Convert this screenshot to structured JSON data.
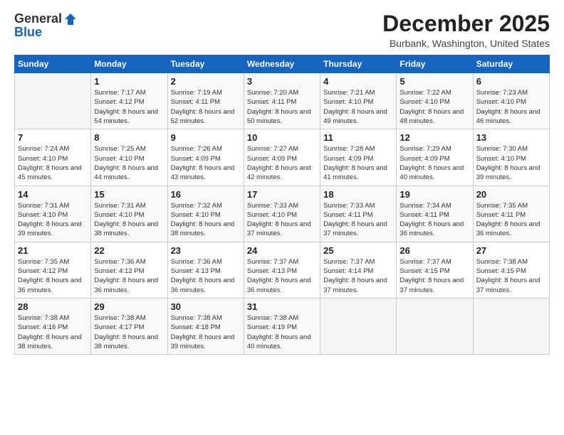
{
  "logo": {
    "general": "General",
    "blue": "Blue"
  },
  "title": "December 2025",
  "location": "Burbank, Washington, United States",
  "days_of_week": [
    "Sunday",
    "Monday",
    "Tuesday",
    "Wednesday",
    "Thursday",
    "Friday",
    "Saturday"
  ],
  "weeks": [
    [
      {
        "day": "",
        "sunrise": "",
        "sunset": "",
        "daylight": ""
      },
      {
        "day": "1",
        "sunrise": "Sunrise: 7:17 AM",
        "sunset": "Sunset: 4:12 PM",
        "daylight": "Daylight: 8 hours and 54 minutes."
      },
      {
        "day": "2",
        "sunrise": "Sunrise: 7:19 AM",
        "sunset": "Sunset: 4:11 PM",
        "daylight": "Daylight: 8 hours and 52 minutes."
      },
      {
        "day": "3",
        "sunrise": "Sunrise: 7:20 AM",
        "sunset": "Sunset: 4:11 PM",
        "daylight": "Daylight: 8 hours and 50 minutes."
      },
      {
        "day": "4",
        "sunrise": "Sunrise: 7:21 AM",
        "sunset": "Sunset: 4:10 PM",
        "daylight": "Daylight: 8 hours and 49 minutes."
      },
      {
        "day": "5",
        "sunrise": "Sunrise: 7:22 AM",
        "sunset": "Sunset: 4:10 PM",
        "daylight": "Daylight: 8 hours and 48 minutes."
      },
      {
        "day": "6",
        "sunrise": "Sunrise: 7:23 AM",
        "sunset": "Sunset: 4:10 PM",
        "daylight": "Daylight: 8 hours and 46 minutes."
      }
    ],
    [
      {
        "day": "7",
        "sunrise": "Sunrise: 7:24 AM",
        "sunset": "Sunset: 4:10 PM",
        "daylight": "Daylight: 8 hours and 45 minutes."
      },
      {
        "day": "8",
        "sunrise": "Sunrise: 7:25 AM",
        "sunset": "Sunset: 4:10 PM",
        "daylight": "Daylight: 8 hours and 44 minutes."
      },
      {
        "day": "9",
        "sunrise": "Sunrise: 7:26 AM",
        "sunset": "Sunset: 4:09 PM",
        "daylight": "Daylight: 8 hours and 43 minutes."
      },
      {
        "day": "10",
        "sunrise": "Sunrise: 7:27 AM",
        "sunset": "Sunset: 4:09 PM",
        "daylight": "Daylight: 8 hours and 42 minutes."
      },
      {
        "day": "11",
        "sunrise": "Sunrise: 7:28 AM",
        "sunset": "Sunset: 4:09 PM",
        "daylight": "Daylight: 8 hours and 41 minutes."
      },
      {
        "day": "12",
        "sunrise": "Sunrise: 7:29 AM",
        "sunset": "Sunset: 4:09 PM",
        "daylight": "Daylight: 8 hours and 40 minutes."
      },
      {
        "day": "13",
        "sunrise": "Sunrise: 7:30 AM",
        "sunset": "Sunset: 4:10 PM",
        "daylight": "Daylight: 8 hours and 39 minutes."
      }
    ],
    [
      {
        "day": "14",
        "sunrise": "Sunrise: 7:31 AM",
        "sunset": "Sunset: 4:10 PM",
        "daylight": "Daylight: 8 hours and 39 minutes."
      },
      {
        "day": "15",
        "sunrise": "Sunrise: 7:31 AM",
        "sunset": "Sunset: 4:10 PM",
        "daylight": "Daylight: 8 hours and 38 minutes."
      },
      {
        "day": "16",
        "sunrise": "Sunrise: 7:32 AM",
        "sunset": "Sunset: 4:10 PM",
        "daylight": "Daylight: 8 hours and 38 minutes."
      },
      {
        "day": "17",
        "sunrise": "Sunrise: 7:33 AM",
        "sunset": "Sunset: 4:10 PM",
        "daylight": "Daylight: 8 hours and 37 minutes."
      },
      {
        "day": "18",
        "sunrise": "Sunrise: 7:33 AM",
        "sunset": "Sunset: 4:11 PM",
        "daylight": "Daylight: 8 hours and 37 minutes."
      },
      {
        "day": "19",
        "sunrise": "Sunrise: 7:34 AM",
        "sunset": "Sunset: 4:11 PM",
        "daylight": "Daylight: 8 hours and 36 minutes."
      },
      {
        "day": "20",
        "sunrise": "Sunrise: 7:35 AM",
        "sunset": "Sunset: 4:11 PM",
        "daylight": "Daylight: 8 hours and 36 minutes."
      }
    ],
    [
      {
        "day": "21",
        "sunrise": "Sunrise: 7:35 AM",
        "sunset": "Sunset: 4:12 PM",
        "daylight": "Daylight: 8 hours and 36 minutes."
      },
      {
        "day": "22",
        "sunrise": "Sunrise: 7:36 AM",
        "sunset": "Sunset: 4:12 PM",
        "daylight": "Daylight: 8 hours and 36 minutes."
      },
      {
        "day": "23",
        "sunrise": "Sunrise: 7:36 AM",
        "sunset": "Sunset: 4:13 PM",
        "daylight": "Daylight: 8 hours and 36 minutes."
      },
      {
        "day": "24",
        "sunrise": "Sunrise: 7:37 AM",
        "sunset": "Sunset: 4:13 PM",
        "daylight": "Daylight: 8 hours and 36 minutes."
      },
      {
        "day": "25",
        "sunrise": "Sunrise: 7:37 AM",
        "sunset": "Sunset: 4:14 PM",
        "daylight": "Daylight: 8 hours and 37 minutes."
      },
      {
        "day": "26",
        "sunrise": "Sunrise: 7:37 AM",
        "sunset": "Sunset: 4:15 PM",
        "daylight": "Daylight: 8 hours and 37 minutes."
      },
      {
        "day": "27",
        "sunrise": "Sunrise: 7:38 AM",
        "sunset": "Sunset: 4:15 PM",
        "daylight": "Daylight: 8 hours and 37 minutes."
      }
    ],
    [
      {
        "day": "28",
        "sunrise": "Sunrise: 7:38 AM",
        "sunset": "Sunset: 4:16 PM",
        "daylight": "Daylight: 8 hours and 38 minutes."
      },
      {
        "day": "29",
        "sunrise": "Sunrise: 7:38 AM",
        "sunset": "Sunset: 4:17 PM",
        "daylight": "Daylight: 8 hours and 38 minutes."
      },
      {
        "day": "30",
        "sunrise": "Sunrise: 7:38 AM",
        "sunset": "Sunset: 4:18 PM",
        "daylight": "Daylight: 8 hours and 39 minutes."
      },
      {
        "day": "31",
        "sunrise": "Sunrise: 7:38 AM",
        "sunset": "Sunset: 4:19 PM",
        "daylight": "Daylight: 8 hours and 40 minutes."
      },
      {
        "day": "",
        "sunrise": "",
        "sunset": "",
        "daylight": ""
      },
      {
        "day": "",
        "sunrise": "",
        "sunset": "",
        "daylight": ""
      },
      {
        "day": "",
        "sunrise": "",
        "sunset": "",
        "daylight": ""
      }
    ]
  ]
}
